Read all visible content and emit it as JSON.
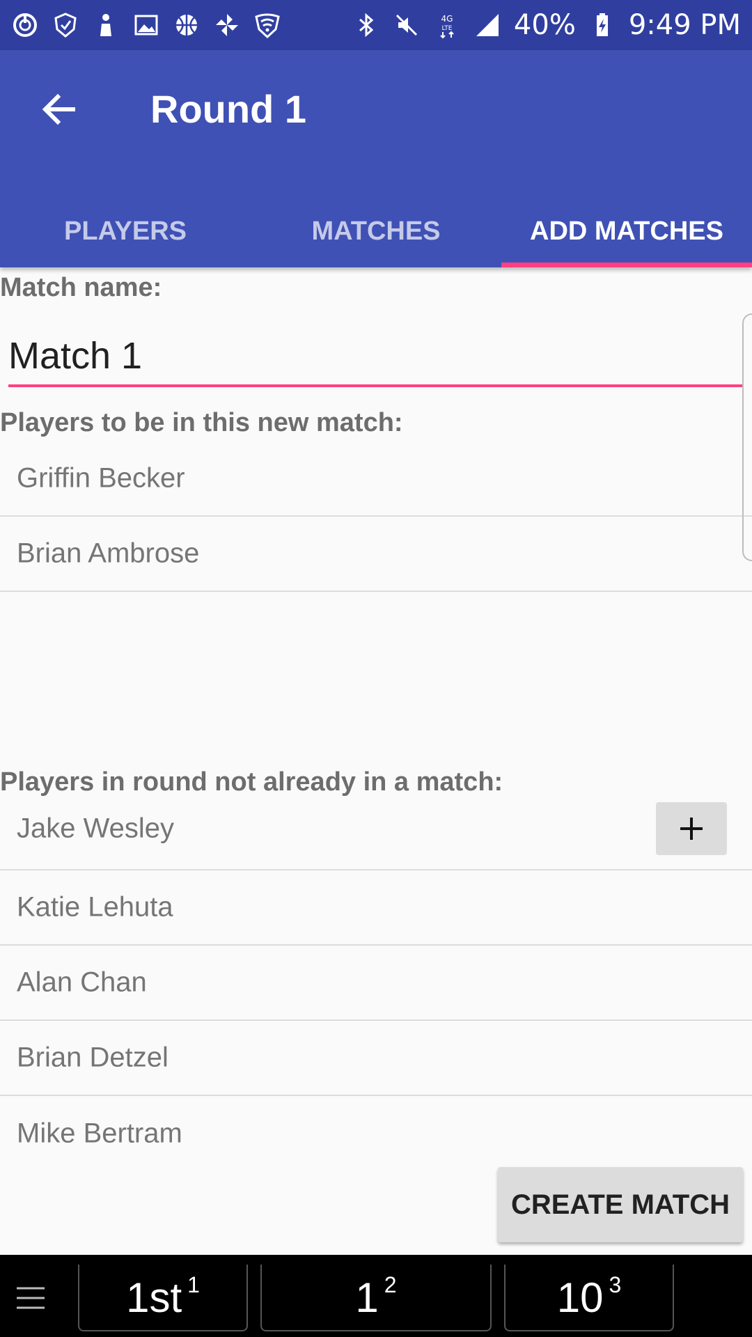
{
  "status_bar": {
    "battery": "40%",
    "time": "9:49 PM",
    "left_icons": [
      "power-icon",
      "shield-icon",
      "person-icon",
      "gallery-icon",
      "basketball-icon",
      "pinwheel-icon",
      "wifi-shield-icon"
    ],
    "right_icons": [
      "bluetooth-icon",
      "mute-icon",
      "4g-lte-icon",
      "signal-icon",
      "battery-icon"
    ]
  },
  "app_bar": {
    "title": "Round 1",
    "tabs": [
      {
        "label": "PLAYERS",
        "active": false
      },
      {
        "label": "MATCHES",
        "active": false
      },
      {
        "label": "ADD MATCHES",
        "active": true
      }
    ]
  },
  "form": {
    "match_name_label": "Match name:",
    "match_name_value": "Match 1",
    "players_in_match_label": "Players to be in this new match:",
    "players_in_match": [
      "Griffin Becker",
      "Brian Ambrose"
    ],
    "players_available_label": "Players in round not already in a match:",
    "players_available": [
      "Jake Wesley",
      "Katie Lehuta",
      "Alan Chan",
      "Brian Detzel",
      "Mike Bertram"
    ],
    "add_button_label": "+",
    "create_button_label": "CREATE MATCH"
  },
  "bottom_bar": {
    "buttons": [
      {
        "main": "1st",
        "sup": "1"
      },
      {
        "main": "1",
        "sup": "2"
      },
      {
        "main": "10",
        "sup": "3"
      }
    ]
  },
  "colors": {
    "status_bar": "#303f9f",
    "primary": "#3f51b5",
    "accent": "#ff4081"
  }
}
